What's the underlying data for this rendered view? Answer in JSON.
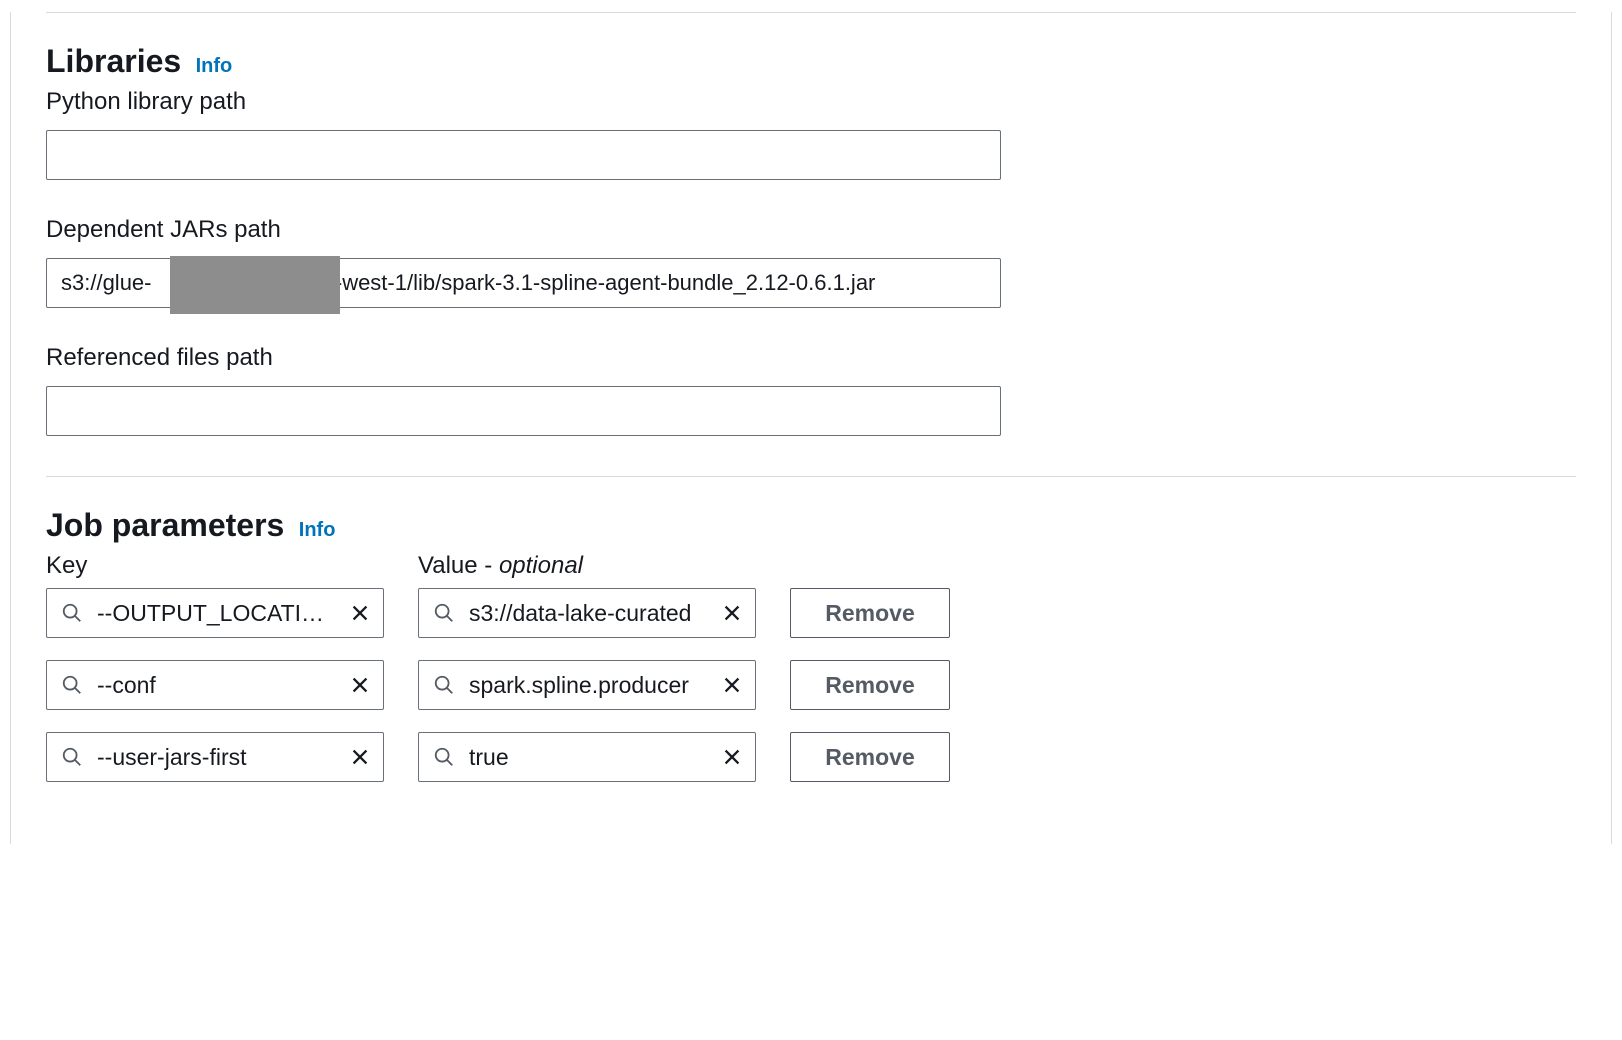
{
  "libraries": {
    "title": "Libraries",
    "info_label": "Info",
    "python_path": {
      "label": "Python library path",
      "value": ""
    },
    "jars_path": {
      "label": "Dependent JARs path",
      "value": "s3://glue-                         -us-west-1/lib/spark-3.1-spline-agent-bundle_2.12-0.6.1.jar"
    },
    "referenced_path": {
      "label": "Referenced files path",
      "value": ""
    }
  },
  "job_parameters": {
    "title": "Job parameters",
    "info_label": "Info",
    "key_header": "Key",
    "value_header_prefix": "Value - ",
    "value_header_optional": "optional",
    "remove_label": "Remove",
    "rows": [
      {
        "key": "--OUTPUT_LOCATION",
        "value": "s3://data-lake-curated"
      },
      {
        "key": "--conf",
        "value": "spark.spline.producer"
      },
      {
        "key": "--user-jars-first",
        "value": "true"
      }
    ]
  }
}
